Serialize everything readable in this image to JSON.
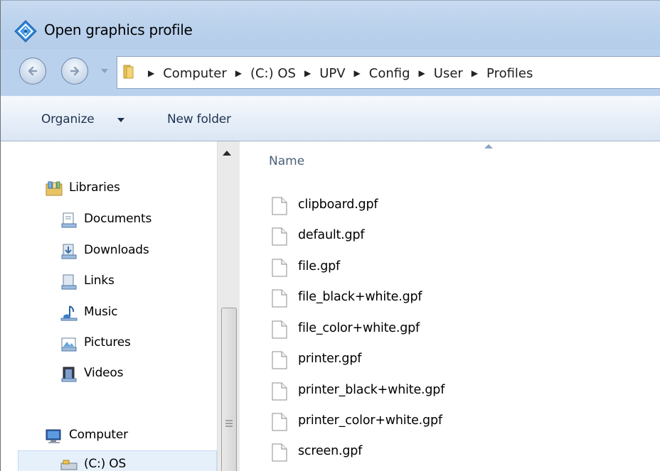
{
  "window": {
    "title": "Open graphics profile"
  },
  "address": {
    "breadcrumbs": [
      "Computer",
      "(C:) OS",
      "UPV",
      "Config",
      "User",
      "Profiles"
    ]
  },
  "toolbar": {
    "organize_label": "Organize",
    "new_folder_label": "New folder"
  },
  "nav_pane": {
    "libraries_label": "Libraries",
    "library_items": [
      {
        "label": "Documents",
        "icon": "documents-library-icon"
      },
      {
        "label": "Downloads",
        "icon": "downloads-library-icon"
      },
      {
        "label": "Links",
        "icon": "links-library-icon"
      },
      {
        "label": "Music",
        "icon": "music-library-icon"
      },
      {
        "label": "Pictures",
        "icon": "pictures-library-icon"
      },
      {
        "label": "Videos",
        "icon": "videos-library-icon"
      }
    ],
    "computer_label": "Computer",
    "drive_label": "(C:) OS"
  },
  "file_list": {
    "column_name": "Name",
    "files": [
      "clipboard.gpf",
      "default.gpf",
      "file.gpf",
      "file_black+white.gpf",
      "file_color+white.gpf",
      "printer.gpf",
      "printer_black+white.gpf",
      "printer_color+white.gpf",
      "screen.gpf"
    ]
  },
  "colors": {
    "titlebar": "#b9d1ec",
    "toolbar_text": "#1e3250",
    "column_header_text": "#4c607a",
    "selection": "#e6f0fb"
  }
}
